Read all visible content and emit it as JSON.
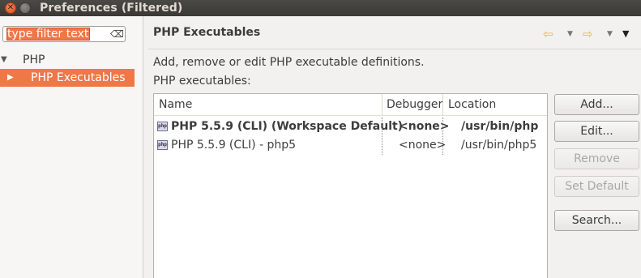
{
  "window": {
    "title": "Preferences (Filtered)"
  },
  "sidebar": {
    "filter": {
      "value": "type filter text"
    },
    "tree": [
      {
        "label": "PHP",
        "expanded": true
      },
      {
        "label": "PHP Executables",
        "selected": true
      }
    ]
  },
  "page": {
    "title": "PHP Executables",
    "description": "Add, remove or edit PHP executable definitions.",
    "list_label": "PHP executables:"
  },
  "table": {
    "columns": [
      "Name",
      "Debugger",
      "Location"
    ],
    "rows": [
      {
        "name": "PHP 5.5.9 (CLI) (Workspace Default)",
        "debugger": "<none>",
        "location": "/usr/bin/php",
        "is_default": true
      },
      {
        "name": "PHP 5.5.9 (CLI) - php5",
        "debugger": "<none>",
        "location": "/usr/bin/php5",
        "is_default": false
      }
    ]
  },
  "buttons": {
    "add": "Add...",
    "edit": "Edit...",
    "remove": "Remove",
    "set_default": "Set Default",
    "search": "Search..."
  },
  "icons": {
    "close": "close-icon",
    "minimize": "minimize-icon",
    "clear_filter": "clear-filter-icon",
    "back": "back-arrow-icon",
    "forward": "forward-arrow-icon",
    "view_menu": "view-menu-icon",
    "php_executable": "php-icon"
  },
  "colors": {
    "selection": "#f07746",
    "titlebar": "#3c3b37",
    "nav_arrow": "#e8b24a"
  }
}
